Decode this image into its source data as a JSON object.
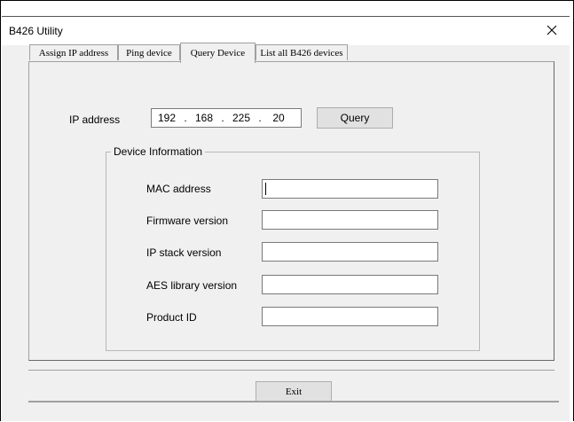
{
  "window": {
    "title": "B426 Utility",
    "close_glyph": "✕"
  },
  "tabs": [
    {
      "label": "Assign IP address",
      "active": false
    },
    {
      "label": "Ping device",
      "active": false
    },
    {
      "label": "Query Device",
      "active": true
    },
    {
      "label": "List all B426 devices",
      "active": false
    }
  ],
  "query": {
    "ip_label": "IP address",
    "ip_octets": [
      "192",
      "168",
      "225",
      "20"
    ],
    "ip_separator": ".",
    "query_button": "Query"
  },
  "device_info": {
    "group_title": "Device Information",
    "fields": [
      {
        "label": "MAC address",
        "value": ""
      },
      {
        "label": "Firmware version",
        "value": ""
      },
      {
        "label": "IP stack version",
        "value": ""
      },
      {
        "label": "AES library version",
        "value": ""
      },
      {
        "label": "Product ID",
        "value": ""
      }
    ]
  },
  "footer": {
    "exit_button": "Exit"
  }
}
